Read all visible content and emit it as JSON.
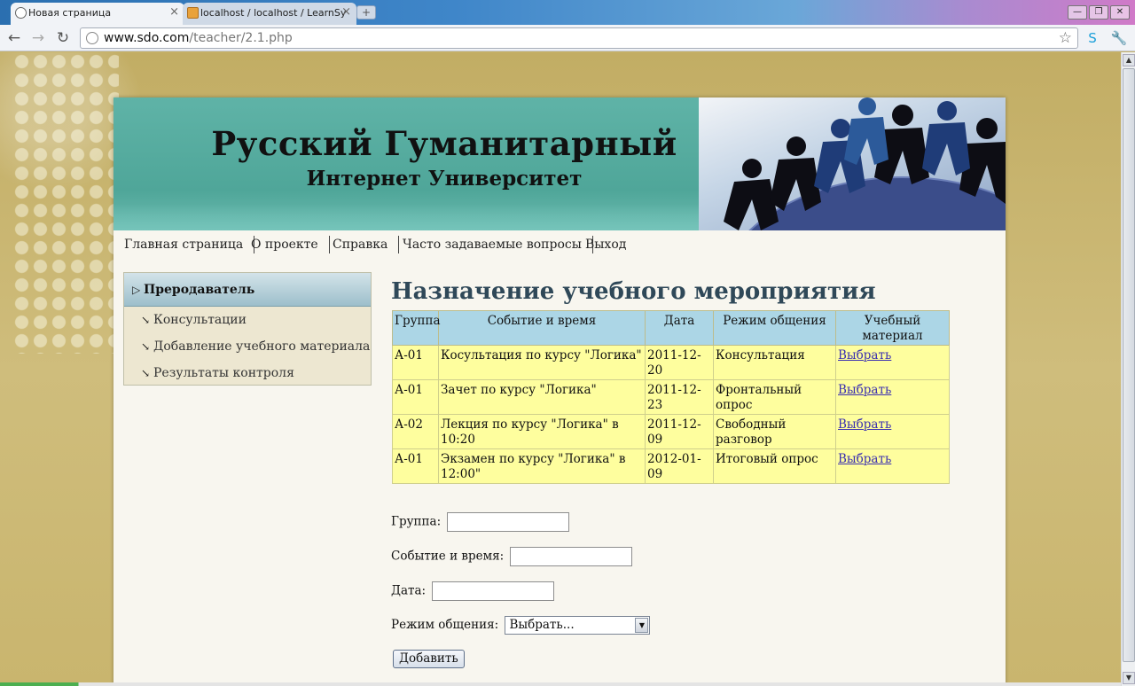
{
  "browser": {
    "tabs": [
      {
        "label": "Новая страница",
        "active": true
      },
      {
        "label": "localhost / localhost / LearnSy",
        "active": false
      }
    ],
    "new_tab_symbol": "+",
    "window_buttons": [
      "—",
      "❐",
      "✕"
    ],
    "url_host": "www.sdo.com",
    "url_path": "/teacher/2.1.php",
    "icons": [
      "back-arrow-icon",
      "forward-arrow-icon",
      "reload-icon",
      "globe-icon",
      "star-icon",
      "skype-icon",
      "wrench-icon"
    ]
  },
  "site": {
    "title": "Русский Гуманитарный",
    "subtitle": "Интернет Университет",
    "nav": [
      "Главная страница",
      "О проекте",
      "Справка",
      "Часто задаваемые вопросы",
      "Выход"
    ]
  },
  "sidebar": {
    "heading": "Преродаватель",
    "items": [
      "Консультации",
      "Добавление учебного материала",
      "Результаты контроля"
    ]
  },
  "main": {
    "title": "Назначение учебного мероприятия",
    "table": {
      "headers": [
        "Группа",
        "Событие и время",
        "Дата",
        "Режим общения",
        "Учебный материал"
      ],
      "rows": [
        [
          "А-01",
          "Косультация по курсу \"Логика\"",
          "2011-12-20",
          "Консультация",
          "Выбрать"
        ],
        [
          "А-01",
          "Зачет по курсу \"Логика\"",
          "2011-12-23",
          "Фронтальный опрос",
          "Выбрать"
        ],
        [
          "А-02",
          "Лекция по курсу \"Логика\" в 10:20",
          "2011-12-09",
          "Свободный разговор",
          "Выбрать"
        ],
        [
          "А-01",
          "Экзамен по курсу \"Логика\" в 12:00\"",
          "2012-01-09",
          "Итоговый опрос",
          "Выбрать"
        ]
      ]
    },
    "form": {
      "group_label": "Группа:",
      "group_value": "",
      "event_label": "Событие и время:",
      "event_value": "",
      "date_label": "Дата:",
      "date_value": "",
      "mode_label": "Режим общения:",
      "mode_selected": "Выбрать...",
      "submit_label": "Добавить"
    }
  },
  "colors": {
    "banner": "#4fa699",
    "table_header": "#acd6e6",
    "table_cell": "#fefe9e",
    "page_background": "#c8b46a",
    "link": "#3a2fb0"
  }
}
